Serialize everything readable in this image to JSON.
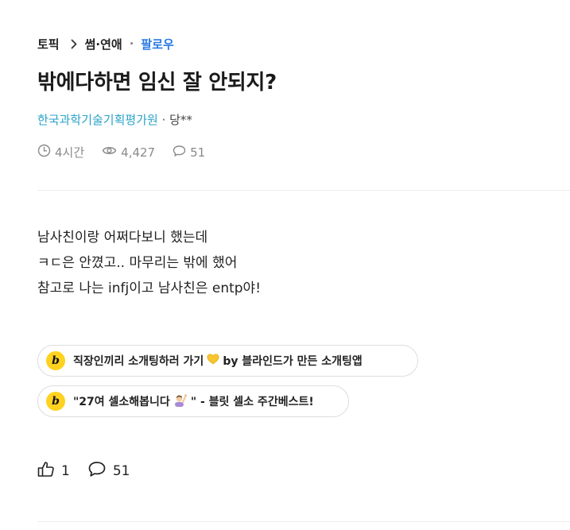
{
  "breadcrumb": {
    "root": "토픽",
    "category": "썸·연애",
    "separator": "·",
    "follow": "팔로우"
  },
  "post": {
    "title": "밖에다하면 임신 잘 안되지?",
    "company": "한국과학기술기획평가원",
    "author_separator": " · ",
    "nickname": "당**",
    "stats": {
      "time": "4시간",
      "views": "4,427",
      "comments": "51"
    },
    "body": [
      "남사친이랑 어쩌다보니 했는데",
      "ㅋㄷ은 안꼈고.. 마무리는 밖에 했어",
      "참고로 나는 infj이고 남사친은 entp야!"
    ]
  },
  "ads": [
    {
      "logo": "b",
      "text_before": "직장인끼리 소개팅하러 가기",
      "emoji": "yellow-heart-icon",
      "text_after": "by 블라인드가 만든 소개팅앱"
    },
    {
      "logo": "b",
      "text_before": "\"27여 셀소해봅니다",
      "emoji": "person-raising-hand-icon",
      "text_after": "\" - 블릿 셀소 주간베스트!"
    }
  ],
  "actions": {
    "likes": "1",
    "comments": "51"
  },
  "colors": {
    "follow": "#2a7ae4",
    "company": "#2aa3c7",
    "muted": "#8a8a8a",
    "logo_bg": "#ffd21f"
  }
}
